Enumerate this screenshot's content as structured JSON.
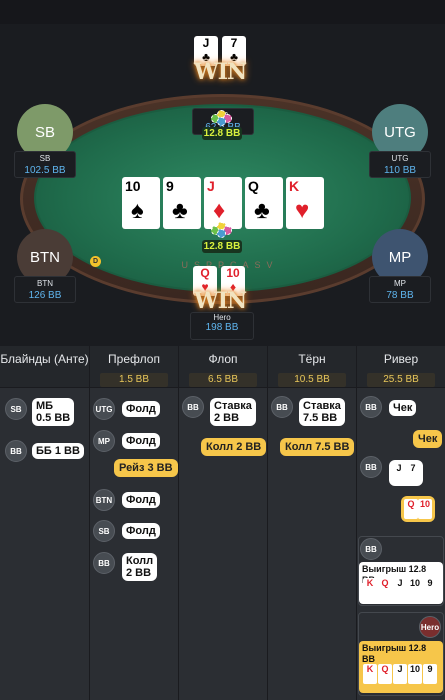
{
  "seats": {
    "sb": {
      "circle": "SB",
      "name": "SB",
      "stack": "102.5 BB"
    },
    "utg": {
      "circle": "UTG",
      "name": "UTG",
      "stack": "110 BB"
    },
    "btn": {
      "circle": "BTN",
      "name": "BTN",
      "stack": "126 BB"
    },
    "mp": {
      "circle": "MP",
      "name": "MP",
      "stack": "78 BB"
    },
    "bb": {
      "name": "BB",
      "stack": "62.5 BB"
    },
    "hero": {
      "name": "Hero",
      "stack": "198 BB"
    }
  },
  "bb_cards": [
    {
      "rank": "J",
      "suit": "♣"
    },
    {
      "rank": "7",
      "suit": "♣"
    }
  ],
  "hero_cards": [
    {
      "rank": "Q",
      "suit": "♥"
    },
    {
      "rank": "10",
      "suit": "♦"
    }
  ],
  "win_text": "WIN",
  "dealer_label": "D",
  "rail_text": "USPPCASV",
  "top_pot": "12.8 BB",
  "bottom_pot": "12.8 BB",
  "board": [
    {
      "rank": "10",
      "suit": "♠",
      "color": "#111111"
    },
    {
      "rank": "9",
      "suit": "♣",
      "color": "#111111"
    },
    {
      "rank": "J",
      "suit": "♦",
      "color": "#e0202b"
    },
    {
      "rank": "Q",
      "suit": "♣",
      "color": "#111111"
    },
    {
      "rank": "K",
      "suit": "♥",
      "color": "#e0202b"
    }
  ],
  "history": {
    "columns": [
      {
        "title": "Блайнды (Анте)",
        "pot": ""
      },
      {
        "title": "Префлоп",
        "pot": "1.5 BB"
      },
      {
        "title": "Флоп",
        "pot": "6.5 BB"
      },
      {
        "title": "Тёрн",
        "pot": "10.5 BB"
      },
      {
        "title": "Ривер",
        "pot": "25.5 BB"
      }
    ],
    "blinds": [
      {
        "avatar": "SB",
        "line1": "МБ",
        "line2": "0.5 BB"
      },
      {
        "avatar": "BB",
        "text": "ББ 1 BB"
      }
    ],
    "preflop": [
      {
        "avatar": "UTG",
        "text": "Фолд"
      },
      {
        "avatar": "MP",
        "text": "Фолд"
      },
      {
        "hero_text": "Рейз 3 BB"
      },
      {
        "avatar": "BTN",
        "text": "Фолд"
      },
      {
        "avatar": "SB",
        "text": "Фолд"
      },
      {
        "avatar": "BB",
        "line1": "Колл",
        "line2": "2 BB"
      }
    ],
    "flop": [
      {
        "avatar": "BB",
        "line1": "Ставка",
        "line2": "2 BB"
      },
      {
        "hero_text": "Колл 2 BB"
      }
    ],
    "turn": [
      {
        "avatar": "BB",
        "line1": "Ставка",
        "line2": "7.5 BB"
      },
      {
        "hero_text": "Колл 7.5 BB"
      }
    ],
    "river": [
      {
        "avatar": "BB",
        "text": "Чек"
      },
      {
        "hero_text": "Чек"
      },
      {
        "avatar": "BB",
        "cards": [
          "J",
          "7"
        ]
      },
      {
        "hero_cards": [
          "Q",
          "10"
        ]
      },
      {
        "avatar": "BB",
        "win_label": "Выигрыш 12.8 BB",
        "cards": [
          "K",
          "Q",
          "J",
          "10",
          "9"
        ]
      },
      {
        "avatar": "Hero",
        "win_label": "Выигрыш 12.8 BB",
        "cards": [
          "K",
          "Q",
          "J",
          "10",
          "9"
        ]
      }
    ]
  }
}
